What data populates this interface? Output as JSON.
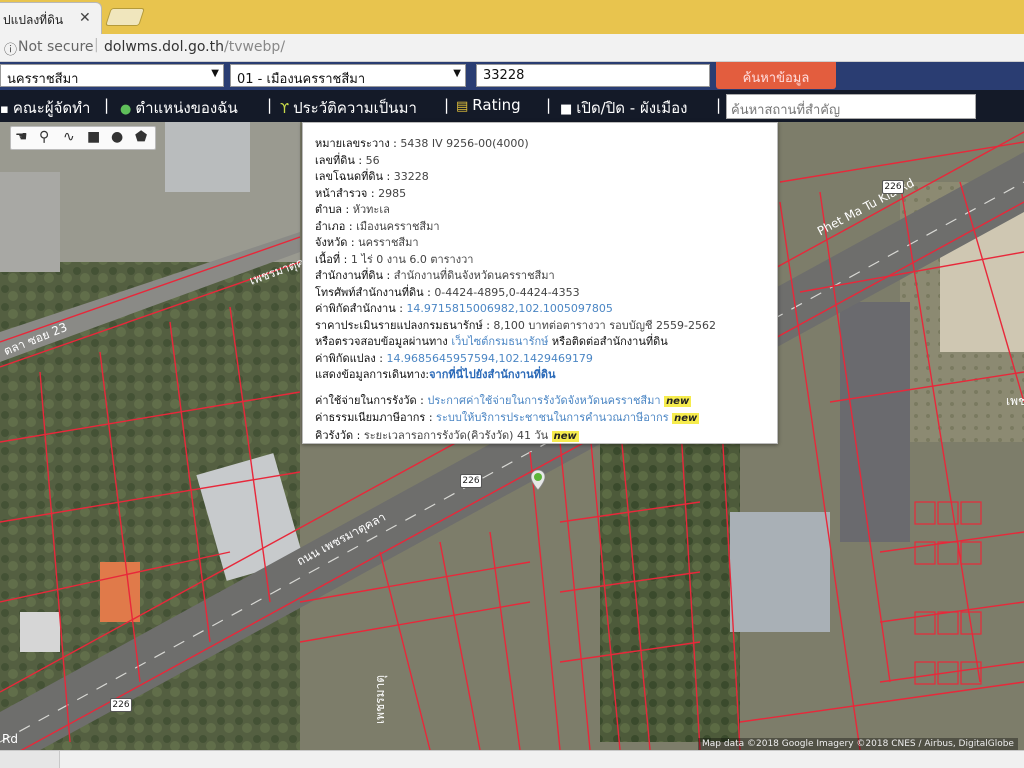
{
  "browser": {
    "tab_title": "ปแปลงที่ดิน",
    "address_security": "Not secure",
    "url_host": "dolwms.dol.go.th",
    "url_path": "/tvwebp/"
  },
  "search": {
    "province": "นครราชสีมา",
    "district": "01 - เมืองนครราชสีมา",
    "parcel_no": "33228",
    "button": "ค้นหาข้อมูล"
  },
  "nav": {
    "item1": "คณะผู้จัดทำ",
    "item2": "ตำแหน่งของฉัน",
    "item3": "ประวัติความเป็นมา",
    "item4": "Rating",
    "item5": "เปิด/ปิด - ผังเมือง",
    "place_placeholder": "ค้นหาสถานที่สำคัญ",
    "separator": "|"
  },
  "popup": {
    "map_sheet_label": "หมายเลขระวาง",
    "map_sheet_value": "5438 IV 9256-00(4000)",
    "land_no_label": "เลขที่ดิน",
    "land_no_value": "56",
    "deed_no_label": "เลขโฉนดที่ดิน",
    "deed_no_value": "33228",
    "survey_label": "หน้าสำรวจ",
    "survey_value": "2985",
    "tambon_label": "ตำบล",
    "tambon_value": "หัวทะเล",
    "amphoe_label": "อำเภอ",
    "amphoe_value": "เมืองนครราชสีมา",
    "province_label": "จังหวัด",
    "province_value": "นครราชสีมา",
    "area_label": "เนื้อที่",
    "area_value": "1 ไร่ 0 งาน 6.0 ตารางวา",
    "office_label": "สำนักงานที่ดิน",
    "office_value": "สำนักงานที่ดินจังหวัดนครราชสีมา",
    "phone_label": "โทรศัพท์สำนักงานที่ดิน",
    "phone_value": "0-4424-4895,0-4424-4353",
    "office_coord_label": "ค่าพิกัดสำนักงาน",
    "office_coord_value": "14.9715815006982,102.1005097805",
    "price_label": "ราคาประเมินรายแปลงกรมธนารักษ์",
    "price_value": "8,100 บาทต่อตารางวา รอบบัญชี 2559-2562",
    "check_prefix": "หรือตรวจสอบข้อมูลผ่านทาง",
    "check_link": "เว็บไซต์กรมธนารักษ์",
    "check_suffix": "หรือติดต่อสำนักงานที่ดิน",
    "parcel_coord_label": "ค่าพิกัดแปลง",
    "parcel_coord_value": "14.9685645957594,102.1429469179",
    "route_label": "แสดงข้อมูลการเดินทาง:",
    "route_link": "จากที่นี่ไปยังสำนักงานที่ดิน",
    "fee_label": "ค่าใช้จ่ายในการรังวัด",
    "fee_link": "ประกาศค่าใช้จ่ายในการรังวัดจังหวัดนครราชสีมา",
    "tax_label": "ค่าธรรมเนียมภาษีอากร",
    "tax_link": "ระบบให้บริการประชาชนในการคำนวณภาษีอากร",
    "queue_label": "คิวรังวัด",
    "queue_value": "ระยะเวลารอการรังวัด(คิวรังวัด) 41 วัน",
    "new_badge": "new",
    "colon": ":"
  },
  "map": {
    "road_label_1": "Phet Ma Tu Kla Rd",
    "road_label_2": "เพชรมาตุคลา",
    "road_label_3": "ตลา ซอย 23",
    "road_label_4": "ถนน เพชรมาตุคลา",
    "road_label_5": "เพชรมาตุ",
    "road_label_6": "Rd",
    "road_label_7": "เพช",
    "route_shield": "226",
    "credit": "Map data ©2018 Google Imagery ©2018 CNES / Airbus, DigitalGlobe"
  },
  "colors": {
    "parcel_line": "#e8283a",
    "nav_bg": "#141a28",
    "search_btn": "#e35d3e"
  }
}
